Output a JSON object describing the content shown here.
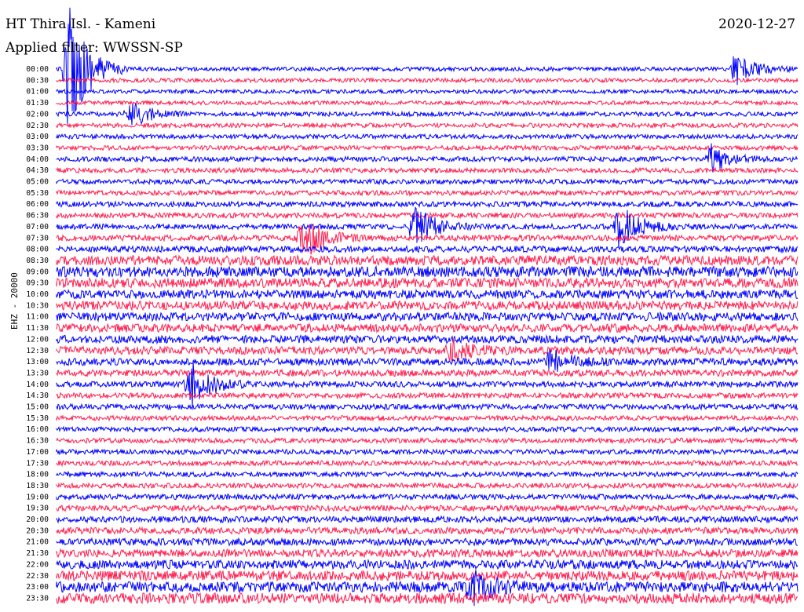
{
  "header": {
    "station": "HT Thira Isl. - Kameni",
    "date": "2020-12-27",
    "filter": "Applied filter: WWSSN-SP"
  },
  "channel_label": "EHZ - 20000",
  "colors": {
    "odd_trace": "#0000ff",
    "even_trace": "#ff1e50"
  },
  "chart_data": {
    "type": "line",
    "title": "",
    "ylabel": "EHZ - 20000",
    "xlabel": "",
    "grid": false,
    "legend": "none",
    "categories": [
      "00:00",
      "00:30",
      "01:00",
      "01:30",
      "02:00",
      "02:30",
      "03:00",
      "03:30",
      "04:00",
      "04:30",
      "05:00",
      "05:30",
      "06:00",
      "06:30",
      "07:00",
      "07:30",
      "08:00",
      "08:30",
      "09:00",
      "09:30",
      "10:00",
      "10:30",
      "11:00",
      "11:30",
      "12:00",
      "12:30",
      "13:00",
      "13:30",
      "14:00",
      "14:30",
      "15:00",
      "15:30",
      "16:00",
      "16:30",
      "17:00",
      "17:30",
      "18:00",
      "18:30",
      "19:00",
      "19:30",
      "20:00",
      "20:30",
      "21:00",
      "21:30",
      "22:00",
      "22:30",
      "23:00",
      "23:30"
    ],
    "noise_level": [
      0.25,
      0.25,
      0.25,
      0.25,
      0.3,
      0.3,
      0.3,
      0.3,
      0.35,
      0.35,
      0.35,
      0.35,
      0.4,
      0.4,
      0.4,
      0.45,
      0.5,
      0.9,
      1.0,
      0.9,
      0.8,
      0.8,
      0.75,
      0.75,
      0.7,
      0.7,
      0.6,
      0.55,
      0.45,
      0.4,
      0.4,
      0.35,
      0.35,
      0.35,
      0.35,
      0.35,
      0.35,
      0.35,
      0.4,
      0.45,
      0.5,
      0.55,
      0.6,
      0.7,
      0.8,
      0.9,
      1.0,
      1.0
    ],
    "events": [
      {
        "line": "00:00",
        "minute": 0.5,
        "amplitude": 6.0
      },
      {
        "line": "00:00",
        "minute": 27.5,
        "amplitude": 1.5
      },
      {
        "line": "02:00",
        "minute": 3.0,
        "amplitude": 1.2
      },
      {
        "line": "04:00",
        "minute": 26.5,
        "amplitude": 1.2
      },
      {
        "line": "07:00",
        "minute": 14.5,
        "amplitude": 2.0
      },
      {
        "line": "07:00",
        "minute": 22.8,
        "amplitude": 2.0
      },
      {
        "line": "07:30",
        "minute": 10.0,
        "amplitude": 2.0
      },
      {
        "line": "14:00",
        "minute": 5.4,
        "amplitude": 2.5
      },
      {
        "line": "12:30",
        "minute": 16.0,
        "amplitude": 1.0
      },
      {
        "line": "13:00",
        "minute": 20.0,
        "amplitude": 1.0
      },
      {
        "line": "23:00",
        "minute": 16.8,
        "amplitude": 1.5
      }
    ]
  }
}
